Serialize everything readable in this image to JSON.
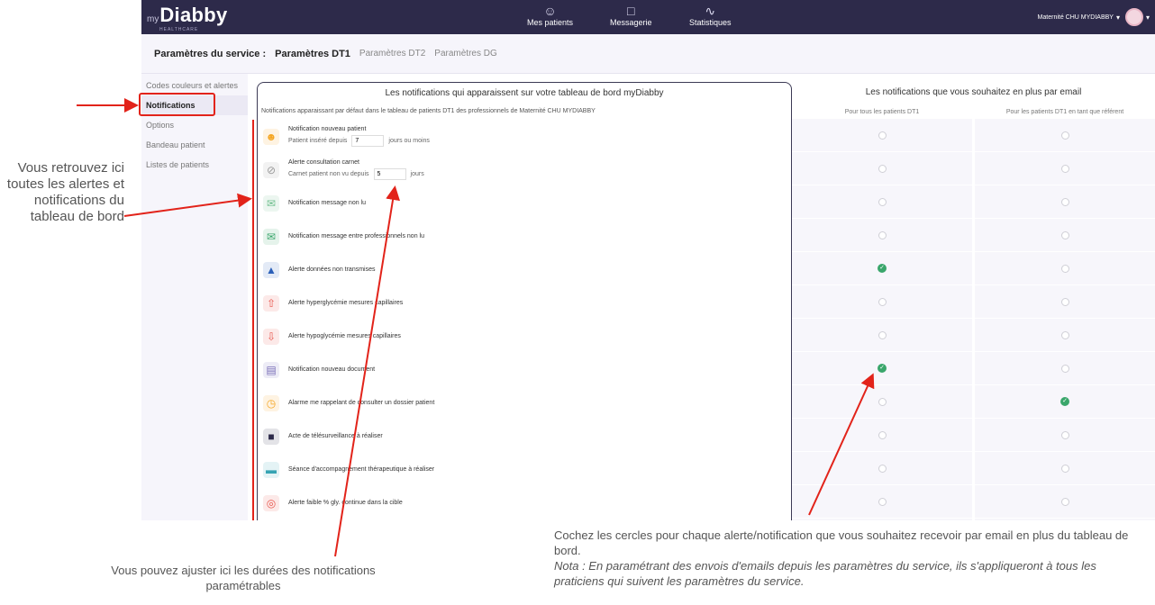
{
  "app": {
    "logo_prefix": "my",
    "logo_name": "Diabby",
    "logo_tag": "HEALTHCARE",
    "nav": [
      {
        "label": "Mes patients",
        "icon": "people-icon"
      },
      {
        "label": "Messagerie",
        "icon": "chat-icon"
      },
      {
        "label": "Statistiques",
        "icon": "stats-icon"
      }
    ],
    "user_name": "Maternité CHU MYDIABBY"
  },
  "tabs": {
    "label": "Paramètres du service :",
    "items": [
      "Paramètres DT1",
      "Paramètres DT2",
      "Paramètres DG"
    ]
  },
  "sidebar": {
    "items": [
      "Codes couleurs et alertes",
      "Notifications",
      "Options",
      "Bandeau patient",
      "Listes de patients"
    ]
  },
  "center": {
    "title": "Les notifications qui apparaissent sur votre tableau de bord myDiabby",
    "subtitle": "Notifications apparaissant par défaut dans le tableau de patients DT1 des professionnels de Maternité CHU MYDIABBY",
    "rows": [
      {
        "label": "Notification nouveau patient",
        "sub_before": "Patient inséré depuis",
        "value": "7",
        "sub_after": "jours ou moins",
        "icon": "user-icon",
        "color": "#f5a623"
      },
      {
        "label": "Alerte consultation carnet",
        "sub_before": "Carnet patient non vu depuis",
        "value": "5",
        "sub_after": "jours",
        "icon": "eye-slash-icon",
        "color": "#9b9b9b"
      },
      {
        "label": "Notification message non lu",
        "icon": "envelope-icon",
        "color": "#6fbf8e"
      },
      {
        "label": "Notification message entre professionnels non lu",
        "icon": "envelope-pro-icon",
        "color": "#3aa66b"
      },
      {
        "label": "Alerte données non transmises",
        "icon": "warning-icon",
        "color": "#2b5fb8"
      },
      {
        "label": "Alerte hyperglycémie mesures capillaires",
        "icon": "arrow-up-icon",
        "color": "#e8584f"
      },
      {
        "label": "Alerte hypoglycémie mesures capillaires",
        "icon": "arrow-down-icon",
        "color": "#e8584f"
      },
      {
        "label": "Notification nouveau document",
        "icon": "document-icon",
        "color": "#7a6fb8"
      },
      {
        "label": "Alarme me rappelant de consulter un dossier patient",
        "icon": "alarm-icon",
        "color": "#f5a623"
      },
      {
        "label": "Acte de télésurveillance à réaliser",
        "icon": "telemonitoring-icon",
        "color": "#2d2a4a"
      },
      {
        "label": "Séance d'accompagnement thérapeutique à réaliser",
        "icon": "therapy-icon",
        "color": "#36a3b3"
      },
      {
        "label": "Alerte faible % gly. continue dans la cible",
        "icon": "target-icon",
        "color": "#e8584f"
      }
    ]
  },
  "right": {
    "title": "Les notifications que vous souhaitez en plus par email",
    "col1": "Pour tous les patients DT1",
    "col2": "Pour les patients DT1 en tant que référent",
    "col1_checked": [
      false,
      false,
      false,
      false,
      true,
      false,
      false,
      true,
      false,
      false,
      false,
      false
    ],
    "col2_checked": [
      false,
      false,
      false,
      false,
      false,
      false,
      false,
      false,
      true,
      false,
      false,
      false
    ]
  },
  "notes": {
    "left": "Vous retrouvez ici toutes les alertes et notifications du tableau de bord",
    "bottom_left": "Vous pouvez ajuster ici les durées des notifications paramétrables",
    "bottom_right_main": "Cochez les cercles pour chaque alerte/notification que vous souhaitez recevoir par email en plus du tableau de bord.",
    "bottom_right_nota": "Nota : En paramétrant des envois d'emails depuis les paramètres du service, ils s'appliqueront à tous les praticiens qui suivent les paramètres du service."
  },
  "colors": {
    "topbar": "#2d2a4a",
    "accent_red": "#e2231a",
    "check_green": "#3aa66b"
  }
}
